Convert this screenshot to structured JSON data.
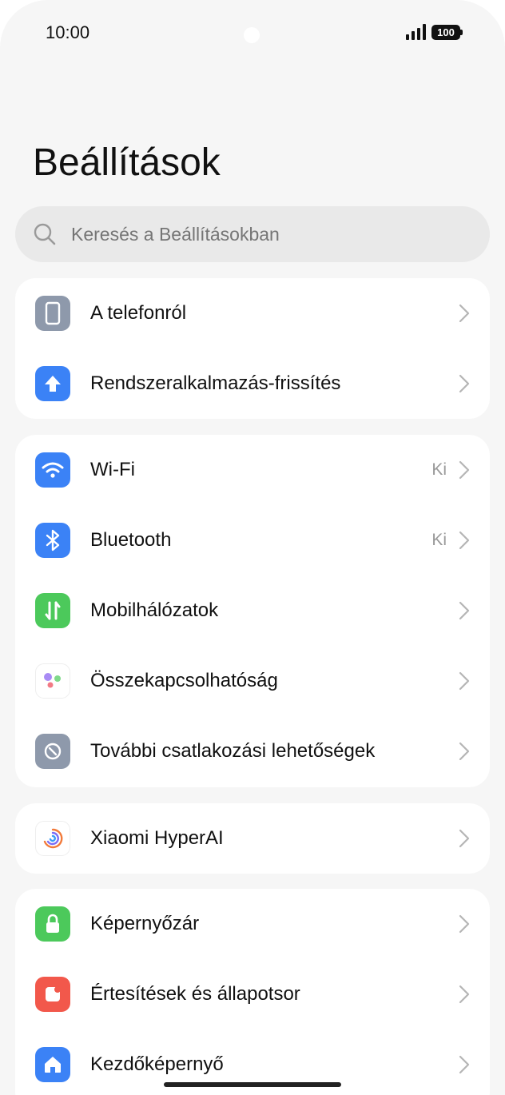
{
  "status_bar": {
    "time": "10:00",
    "battery": "100"
  },
  "page": {
    "title": "Beállítások"
  },
  "search": {
    "placeholder": "Keresés a Beállításokban"
  },
  "groups": [
    {
      "items": [
        {
          "label": "A telefonról",
          "icon": "phone-icon",
          "color": "#8e99ab"
        },
        {
          "label": "Rendszeralkalmazás-frissítés",
          "icon": "update-arrow-icon",
          "color": "#3b82f6"
        }
      ]
    },
    {
      "items": [
        {
          "label": "Wi-Fi",
          "value": "Ki",
          "icon": "wifi-icon",
          "color": "#3b82f6"
        },
        {
          "label": "Bluetooth",
          "value": "Ki",
          "icon": "bluetooth-icon",
          "color": "#3b82f6"
        },
        {
          "label": "Mobilhálózatok",
          "icon": "mobile-data-icon",
          "color": "#4cc95b"
        },
        {
          "label": "Összekapcsolhatóság",
          "icon": "connectivity-dots-icon",
          "color": "#ffffff"
        },
        {
          "label": "További csatlakozási lehetőségek",
          "icon": "link-icon",
          "color": "#8e99ab"
        }
      ]
    },
    {
      "items": [
        {
          "label": "Xiaomi HyperAI",
          "icon": "hyperai-swirl-icon",
          "color": "#ffffff"
        }
      ]
    },
    {
      "items": [
        {
          "label": "Képernyőzár",
          "icon": "lock-icon",
          "color": "#4cc95b"
        },
        {
          "label": "Értesítések és állapotsor",
          "icon": "notification-icon",
          "color": "#f2584b"
        },
        {
          "label": "Kezdőképernyő",
          "icon": "home-icon",
          "color": "#3b82f6"
        }
      ]
    }
  ]
}
